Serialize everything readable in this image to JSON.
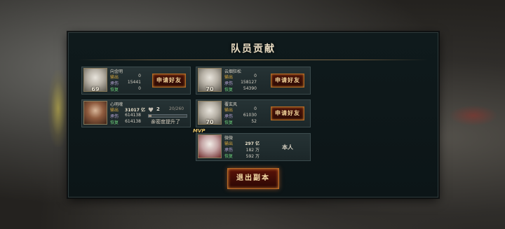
{
  "title": "队员贡献",
  "labels": {
    "output": "输出",
    "taken": "承伤",
    "heal": "恢复"
  },
  "friend_button_label": "申请好友",
  "exit_button_label": "退出副本",
  "members": [
    {
      "name": "向金明",
      "level": "69",
      "output": "0",
      "taken": "15441",
      "heal": "0",
      "action": "申请好友"
    },
    {
      "name": "云烟狂松",
      "level": "70",
      "output": "0",
      "taken": "158127",
      "heal": "54390",
      "action": "申请好友"
    },
    {
      "name": "心明魂",
      "output": "31017 亿",
      "taken": "614138",
      "heal": "614138",
      "favor": "2",
      "favor_progress": "20/260",
      "favor_fraction": 0.077,
      "favor_message": "亲密度提升了"
    },
    {
      "name": "覆玄风",
      "level": "70",
      "output": "0",
      "taken": "61030",
      "heal": "52",
      "action": "申请好友"
    },
    {
      "name": "微微",
      "output": "297 亿",
      "taken": "182 万",
      "heal": "592 万",
      "self_label": "本人",
      "mvp": "MVP"
    }
  ]
}
